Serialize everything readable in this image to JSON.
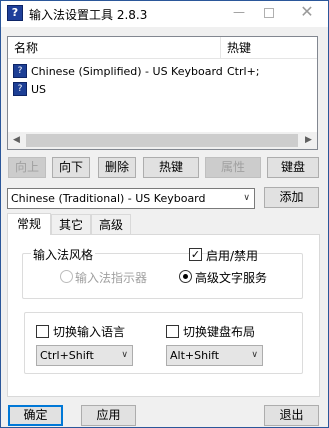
{
  "window": {
    "title": "输入法设置工具 2.8.3",
    "app_icon": "app-icon",
    "minimize_glyph": "—",
    "close_glyph": "✕"
  },
  "list": {
    "headers": [
      "名称",
      "热键"
    ],
    "rows": [
      {
        "name": "Chinese (Simplified) - US Keyboard",
        "hotkey": "Ctrl+;",
        "icon": "ime-icon"
      },
      {
        "name": "US",
        "hotkey": "",
        "icon": "ime-icon"
      }
    ]
  },
  "toolbar": {
    "up": "向上",
    "down": "向下",
    "delete": "删除",
    "hotkey": "热键",
    "properties": "属性",
    "keyboard": "键盘"
  },
  "add_row": {
    "selected": "Chinese (Traditional) - US Keyboard",
    "add": "添加"
  },
  "tabs": [
    "常规",
    "其它",
    "高级"
  ],
  "general": {
    "style_legend": "输入法风格",
    "enable_label": "启用/禁用",
    "enable_checked": true,
    "radio_indicator": "输入法指示器",
    "radio_advanced": "高级文字服务",
    "radio_selected": "advanced",
    "switch_lang_label": "切换输入语言",
    "switch_lang_checked": false,
    "switch_lang_value": "Ctrl+Shift",
    "switch_layout_label": "切换键盘布局",
    "switch_layout_checked": false,
    "switch_layout_value": "Alt+Shift"
  },
  "footer": {
    "ok": "确定",
    "apply": "应用",
    "exit": "退出"
  },
  "colors": {
    "accent": "#0078d7",
    "icon_blue": "#1d3f95"
  }
}
